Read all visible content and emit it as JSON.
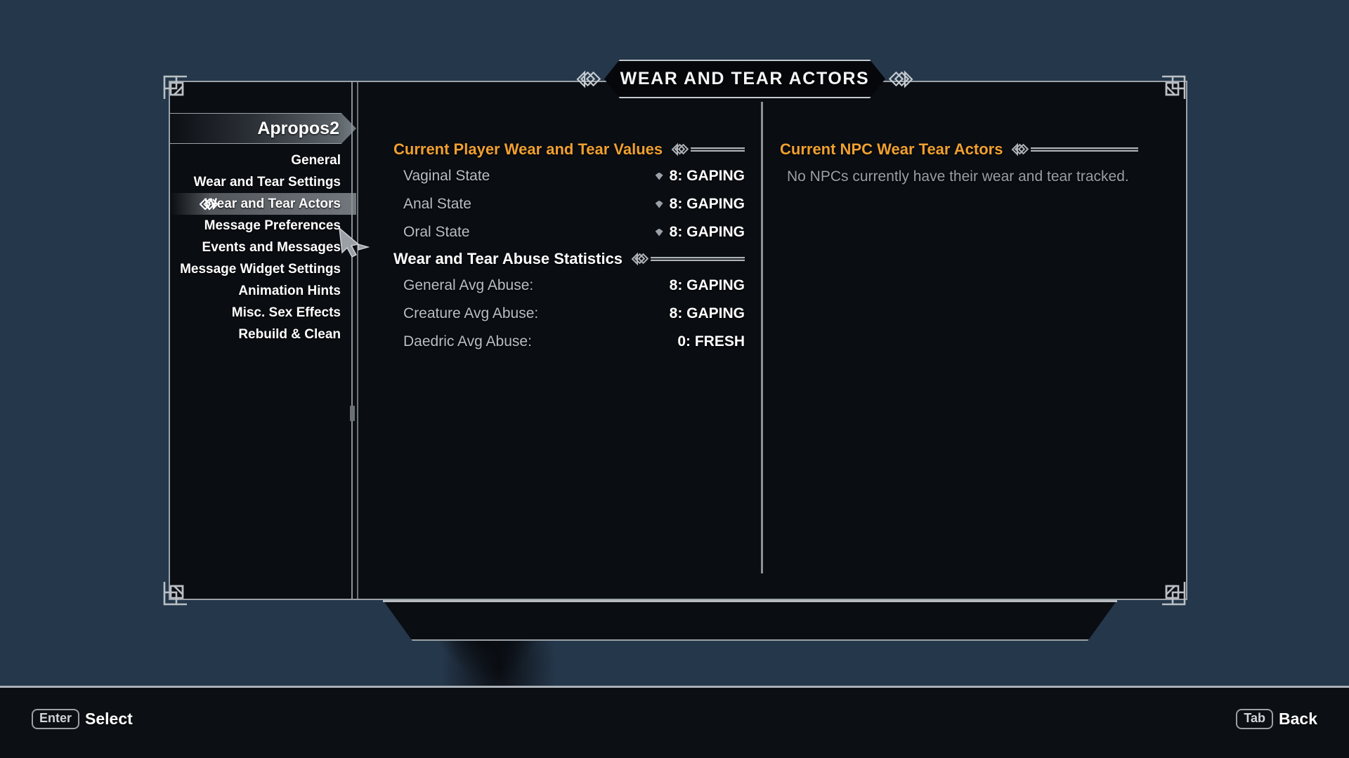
{
  "window": {
    "title": "WEAR AND TEAR ACTORS",
    "background_color": "#25374a",
    "panel_color": "#0a0d12",
    "accent_color": "#f0a030",
    "border_color": "#9aa2a8"
  },
  "sidebar": {
    "mod_name": "Apropos2",
    "items": [
      {
        "label": "General",
        "selected": false
      },
      {
        "label": "Wear and Tear Settings",
        "selected": false
      },
      {
        "label": "Wear and Tear Actors",
        "selected": true
      },
      {
        "label": "Message Preferences",
        "selected": false
      },
      {
        "label": "Events and Messages",
        "selected": false
      },
      {
        "label": "Message Widget Settings",
        "selected": false
      },
      {
        "label": "Animation Hints",
        "selected": false
      },
      {
        "label": "Misc. Sex Effects",
        "selected": false
      },
      {
        "label": "Rebuild & Clean",
        "selected": false
      }
    ]
  },
  "left_column": {
    "sections": [
      {
        "heading": "Current Player Wear and Tear Values",
        "heading_color": "#f0a030",
        "rows": [
          {
            "label": "Vaginal State",
            "value": "8: GAPING",
            "has_marker": true
          },
          {
            "label": "Anal State",
            "value": "8: GAPING",
            "has_marker": true
          },
          {
            "label": "Oral State",
            "value": "8: GAPING",
            "has_marker": true
          }
        ]
      },
      {
        "heading": "Wear and Tear Abuse Statistics",
        "heading_color": "#ffffff",
        "rows": [
          {
            "label": "General Avg Abuse:",
            "value": "8: GAPING",
            "has_marker": false
          },
          {
            "label": "Creature Avg Abuse:",
            "value": "8: GAPING",
            "has_marker": false
          },
          {
            "label": "Daedric Avg Abuse:",
            "value": "0: FRESH",
            "has_marker": false
          }
        ]
      }
    ]
  },
  "right_column": {
    "heading": "Current NPC Wear Tear Actors",
    "heading_color": "#f0a030",
    "empty_message": "No NPCs currently have their wear and tear tracked."
  },
  "footer": {
    "hints": [
      {
        "key": "Enter",
        "action": "Select"
      },
      {
        "key": "Tab",
        "action": "Back"
      }
    ]
  }
}
